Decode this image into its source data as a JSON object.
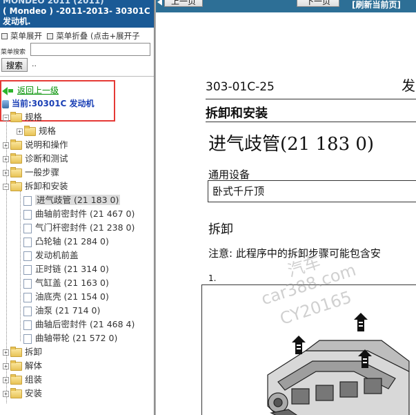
{
  "left_panel": {
    "header_line1": "MONDEO 2011 (2011)",
    "header_line2": "( Mondeo ) -2011-2013- 30301C",
    "header_line3": "发动机.",
    "menu_expand": "菜单展开",
    "menu_collapse": "菜单折叠 (点击+展开子",
    "search_label": "菜单搜索",
    "search_value": "",
    "search_button": "搜索",
    "search_dots": "..",
    "back_link": "返回上一级",
    "current_label": "当前:30301C 发动机",
    "tree": [
      {
        "label": "规格",
        "type": "folder",
        "expanded": true,
        "level": 0
      },
      {
        "label": "规格",
        "type": "folder",
        "expanded": false,
        "level": 1
      },
      {
        "label": "说明和操作",
        "type": "folder",
        "expanded": false,
        "level": 0
      },
      {
        "label": "诊断和测试",
        "type": "folder",
        "expanded": false,
        "level": 0
      },
      {
        "label": "一般步骤",
        "type": "folder",
        "expanded": false,
        "level": 0
      },
      {
        "label": "拆卸和安装",
        "type": "folder",
        "expanded": true,
        "level": 0
      },
      {
        "label": "进气歧管 (21 183 0)",
        "type": "doc",
        "level": 1,
        "selected": true
      },
      {
        "label": "曲轴前密封件 (21 467 0)",
        "type": "doc",
        "level": 1
      },
      {
        "label": "气门杆密封件 (21 238 0)",
        "type": "doc",
        "level": 1
      },
      {
        "label": "凸轮轴 (21 284 0)",
        "type": "doc",
        "level": 1
      },
      {
        "label": "发动机前盖",
        "type": "doc",
        "level": 1
      },
      {
        "label": "正时链 (21 314 0)",
        "type": "doc",
        "level": 1
      },
      {
        "label": "气缸盖 (21 163 0)",
        "type": "doc",
        "level": 1
      },
      {
        "label": "油底壳 (21 154 0)",
        "type": "doc",
        "level": 1
      },
      {
        "label": "油泵 (21 714 0)",
        "type": "doc",
        "level": 1
      },
      {
        "label": "曲轴后密封件 (21 468 4)",
        "type": "doc",
        "level": 1
      },
      {
        "label": "曲轴带轮 (21 572 0)",
        "type": "doc",
        "level": 1
      },
      {
        "label": "拆卸",
        "type": "folder",
        "expanded": false,
        "level": 0
      },
      {
        "label": "解体",
        "type": "folder",
        "expanded": false,
        "level": 0
      },
      {
        "label": "组装",
        "type": "folder",
        "expanded": false,
        "level": 0
      },
      {
        "label": "安装",
        "type": "folder",
        "expanded": false,
        "level": 0
      }
    ]
  },
  "right_panel": {
    "prev_button": "上一页",
    "next_button": "下一页",
    "refresh_link": "[刷新当前页]",
    "section_code": "303-01C-25",
    "section_code_right": "发",
    "section_title": "拆卸和安装",
    "page_title": "进气歧管(21 183 0)",
    "general_equipment_label": "通用设备",
    "equipment_item": "卧式千斤顶",
    "disassembly_heading": "拆卸",
    "note_text": "注意:  此程序中的拆卸步骤可能包含安",
    "step_number": "1.",
    "watermark_lines": [
      "汽车",
      "car388.com",
      "CY20165"
    ]
  },
  "colors": {
    "header_bg": "#1a5a96",
    "topbar_bg": "#2d6f96",
    "highlight_box": "#e53935",
    "back_link": "#009000",
    "current_text": "#1a3fb5"
  }
}
